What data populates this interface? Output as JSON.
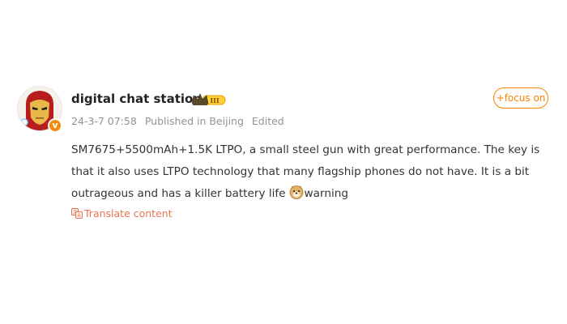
{
  "post": {
    "author": {
      "name": "digital chat station",
      "avatar_icon": "iron-man-avatar-icon",
      "verified_badge": "v",
      "rank_badge_icon": "crown-rank-iii-icon",
      "rank_badge_text": "III"
    },
    "meta": {
      "timestamp": "24-3-7 07:58",
      "location": "Published in Beijing",
      "edited": "Edited"
    },
    "follow_button": "+focus on",
    "content": {
      "text": "SM7675+5500mAh+1.5K LTPO, a small steel gun with great performance. The key is that it also uses LTPO technology that many flagship phones do not have. It is a bit outrageous and has a killer battery life",
      "emoji_icon": "doge-emoji-icon",
      "emoji_label": "warning"
    },
    "translate": {
      "icon": "translate-icon",
      "label": "Translate content"
    }
  },
  "colors": {
    "accent_orange": "#ff8200",
    "translate_link": "#eb7350",
    "meta_gray": "#939393",
    "text": "#333333",
    "username": "#222222",
    "verified_badge": "#f48a10"
  }
}
